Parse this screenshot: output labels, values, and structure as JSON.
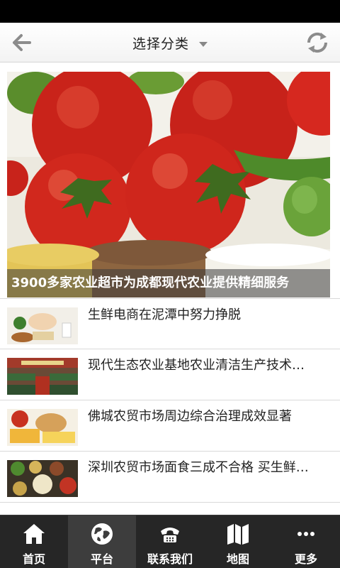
{
  "header": {
    "title": "选择分类",
    "back_icon": "arrow-left-icon",
    "refresh_icon": "refresh-icon"
  },
  "banner": {
    "caption": "3900多家农业超市为成都现代农业提供精细服务"
  },
  "news": [
    {
      "title": "生鲜电商在泥潭中努力挣脱"
    },
    {
      "title": "现代生态农业基地农业清洁生产技术…"
    },
    {
      "title": "佛城农贸市场周边综合治理成效显著"
    },
    {
      "title": "深圳农贸市场面食三成不合格 买生鲜…"
    }
  ],
  "tabs": [
    {
      "label": "首页",
      "icon": "home-icon"
    },
    {
      "label": "平台",
      "icon": "globe-icon"
    },
    {
      "label": "联系我们",
      "icon": "phone-icon"
    },
    {
      "label": "地图",
      "icon": "map-icon"
    },
    {
      "label": "更多",
      "icon": "more-icon"
    }
  ],
  "colors": {
    "status_bar": "#000000",
    "tab_bar": "#262626",
    "tab_active": "#3d3d3d"
  }
}
